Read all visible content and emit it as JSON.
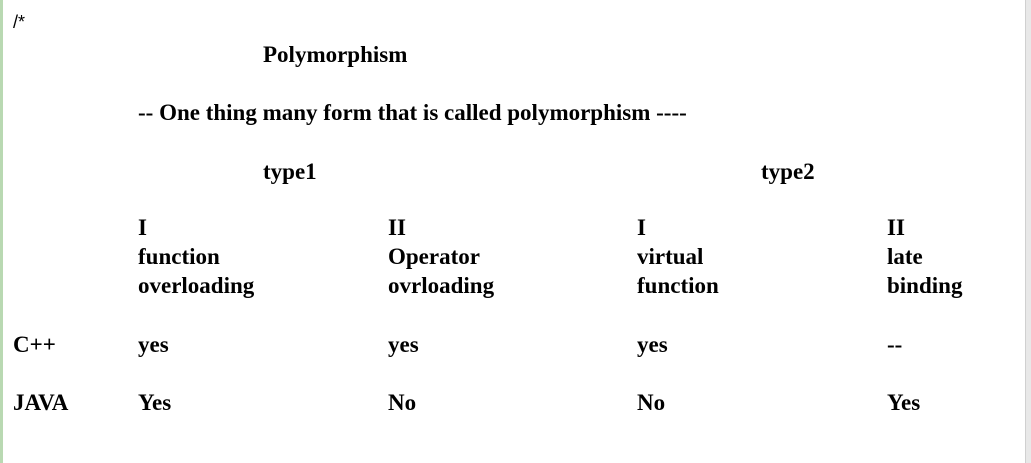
{
  "document": {
    "comment_open": "/*",
    "title": "Polymorphism",
    "definition": "-- One thing many form that is called polymorphism ----",
    "type_headers": [
      "type1",
      "type2"
    ],
    "columns": [
      {
        "number": "I",
        "line1": "function",
        "line2": "overloading"
      },
      {
        "number": "II",
        "line1": "Operator",
        "line2": "ovrloading"
      },
      {
        "number": "I",
        "line1": "virtual",
        "line2": "function"
      },
      {
        "number": "II",
        "line1": "late",
        "line2": "binding"
      }
    ],
    "rows": [
      {
        "label": "C++",
        "values": [
          "yes",
          "yes",
          "yes",
          "--"
        ]
      },
      {
        "label": "JAVA",
        "values": [
          "Yes",
          "No",
          "No",
          "Yes"
        ]
      }
    ]
  }
}
